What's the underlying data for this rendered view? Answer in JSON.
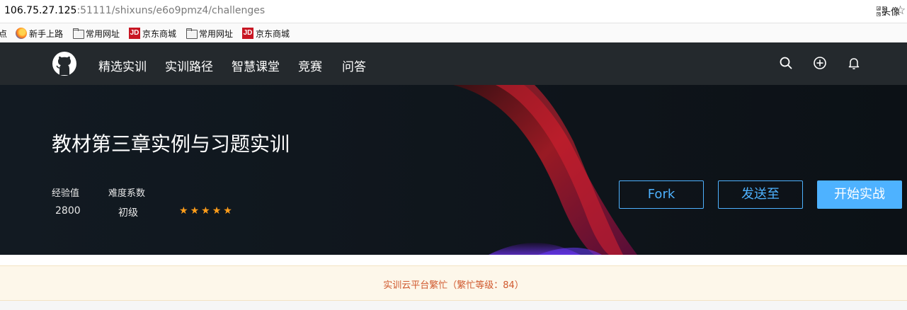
{
  "browser": {
    "url_host": "106.75.27.125",
    "url_rest": ":51111/shixuns/e6o9pmz4/challenges",
    "bookmarks": [
      {
        "label": "点",
        "icon": "none"
      },
      {
        "label": "新手上路",
        "icon": "firefox-icon"
      },
      {
        "label": "常用网址",
        "icon": "folder-icon"
      },
      {
        "label": "京东商城",
        "icon": "jd-icon"
      },
      {
        "label": "常用网址",
        "icon": "folder-icon"
      },
      {
        "label": "京东商城",
        "icon": "jd-icon"
      }
    ],
    "jd_badge": "JD"
  },
  "nav": {
    "links": [
      "精选实训",
      "实训路径",
      "智慧课堂",
      "竞赛",
      "问答"
    ],
    "icons": [
      "search-icon",
      "plus-circle-icon",
      "bell-icon"
    ],
    "avatar_alt": "头像"
  },
  "hero": {
    "title": "教材第三章实例与习题实训",
    "stats": [
      {
        "label": "经验值",
        "value": "2800"
      },
      {
        "label": "难度系数",
        "value": "初级"
      }
    ],
    "rating_stars": 5,
    "buttons": {
      "fork": "Fork",
      "send": "发送至",
      "start": "开始实战"
    }
  },
  "notice": {
    "message": "实训云平台繁忙（繁忙等级：84）"
  },
  "colors": {
    "nav_bg": "#24292d",
    "hero_bg": "#111820",
    "accent": "#4eb2ff",
    "star": "#ff9d1a",
    "notice_text": "#d0592e",
    "notice_bg": "#fdf7ea"
  }
}
